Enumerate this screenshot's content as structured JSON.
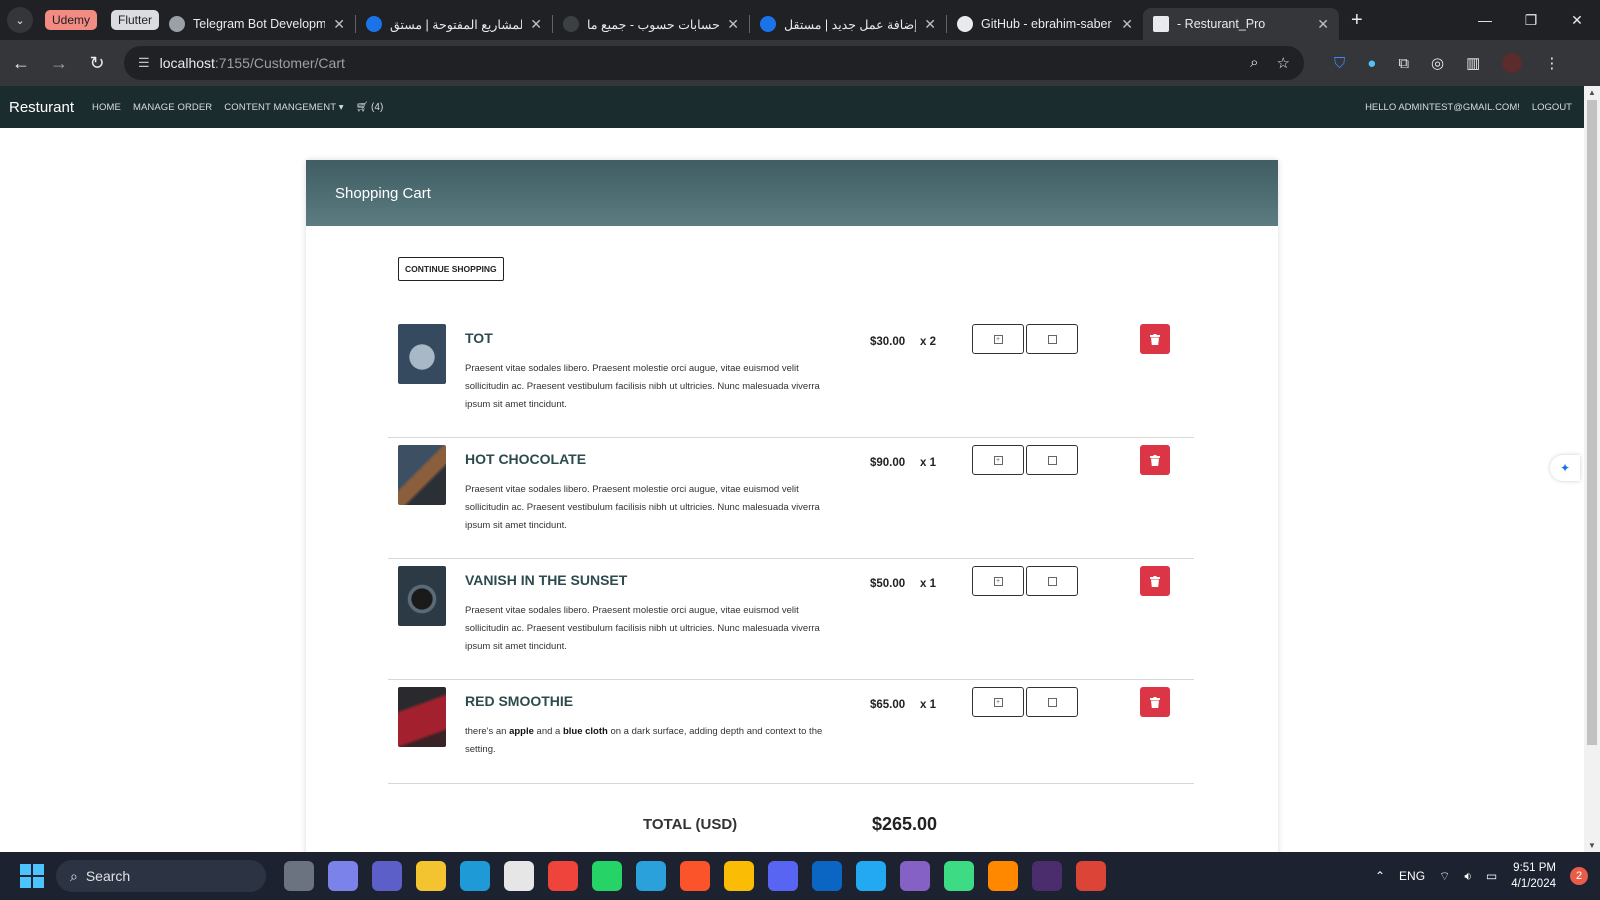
{
  "browser": {
    "tab_groups": [
      "Udemy",
      "Flutter"
    ],
    "tabs": [
      {
        "title": "Telegram Bot Developm",
        "color": "#9aa0a6"
      },
      {
        "title": "المشاريع المفتوحة | مستق",
        "color": "#1a73e8"
      },
      {
        "title": "حسابات حسوب - جميع ما",
        "color": "#202124"
      },
      {
        "title": "إضافة عمل جديد | مستقل",
        "color": "#1a73e8"
      },
      {
        "title": "GitHub - ebrahim-saber",
        "color": "#ffffff"
      },
      {
        "title": "- Resturant_Pro",
        "color": "#e8eaed"
      }
    ],
    "url_host": "localhost",
    "url_path": ":7155/Customer/Cart"
  },
  "navbar": {
    "brand": "Resturant",
    "links": [
      "Home",
      "Manage Order",
      "Content Mangement"
    ],
    "cart_label": "(4)",
    "greeting": "HELLO ADMINTEST@GMAIL.COM!",
    "logout": "LOGOUT"
  },
  "cart": {
    "title": "Shopping Cart",
    "continue_label": "CONTINUE SHOPPING",
    "items": [
      {
        "name": "TOT",
        "desc": "Praesent vitae sodales libero. Praesent molestie orci augue, vitae euismod velit sollicitudin ac. Praesent vestibulum facilisis nibh ut ultricies. Nunc malesuada viverra ipsum sit amet tincidunt.",
        "price": "$30.00",
        "qty": "x 2",
        "thumb_color": "#3d5468"
      },
      {
        "name": "HOT CHOCOLATE",
        "desc": "Praesent vitae sodales libero. Praesent molestie orci augue, vitae euismod velit sollicitudin ac. Praesent vestibulum facilisis nibh ut ultricies. Nunc malesuada viverra ipsum sit amet tincidunt.",
        "price": "$90.00",
        "qty": "x 1",
        "thumb_color": "#4a3a34"
      },
      {
        "name": "VANISH IN THE SUNSET",
        "desc": "Praesent vitae sodales libero. Praesent molestie orci augue, vitae euismod velit sollicitudin ac. Praesent vestibulum facilisis nibh ut ultricies. Nunc malesuada viverra ipsum sit amet tincidunt.",
        "price": "$50.00",
        "qty": "x 1",
        "thumb_color": "#2e3c46"
      },
      {
        "name": "RED SMOOTHIE",
        "desc_parts": [
          "there's an ",
          "apple",
          " and a ",
          "blue cloth",
          " on a dark surface, adding depth and context to the setting."
        ],
        "price": "$65.00",
        "qty": "x 1",
        "thumb_color": "#8a1f2a"
      }
    ],
    "total_label": "TOTAL (USD)",
    "total_value": "$265.00"
  },
  "taskbar": {
    "search_label": "Search",
    "lang": "ENG",
    "time": "9:51 PM",
    "date": "4/1/2024",
    "notifications": "2"
  }
}
